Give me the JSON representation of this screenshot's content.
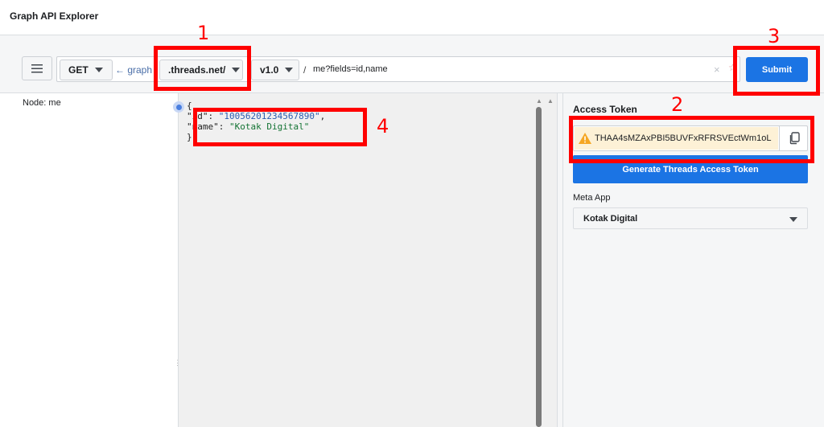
{
  "app": {
    "title": "Graph API Explorer"
  },
  "toolbar": {
    "method": "GET",
    "back_link": "← graph",
    "domain": ".threads.net/",
    "version": "v1.0",
    "separator": "/",
    "query": "me?fields=id,name",
    "clear_symbol": "×",
    "star_symbol": "☆",
    "submit_label": "Submit"
  },
  "node_panel": {
    "label": "Node: me"
  },
  "response": {
    "open_brace": "{",
    "close_brace": "}",
    "lines": [
      {
        "key": "\"id\": ",
        "value": "\"10056201234567890\"",
        "trail": ","
      },
      {
        "key": "\"name\": ",
        "value": "\"Kotak Digital\"",
        "trail": ""
      }
    ]
  },
  "access_token": {
    "label": "Access Token",
    "value": "THAA4sMZAxPBI5BUVFxRFRSVEctWm1oL",
    "generate_label": "Generate Threads Access Token"
  },
  "meta_app": {
    "label": "Meta App",
    "selected": "Kotak Digital"
  },
  "callouts": [
    "1",
    "2",
    "3",
    "4"
  ],
  "colors": {
    "accent": "#1b74e4",
    "annotation": "#ff0000",
    "warning": "#f5a623"
  }
}
